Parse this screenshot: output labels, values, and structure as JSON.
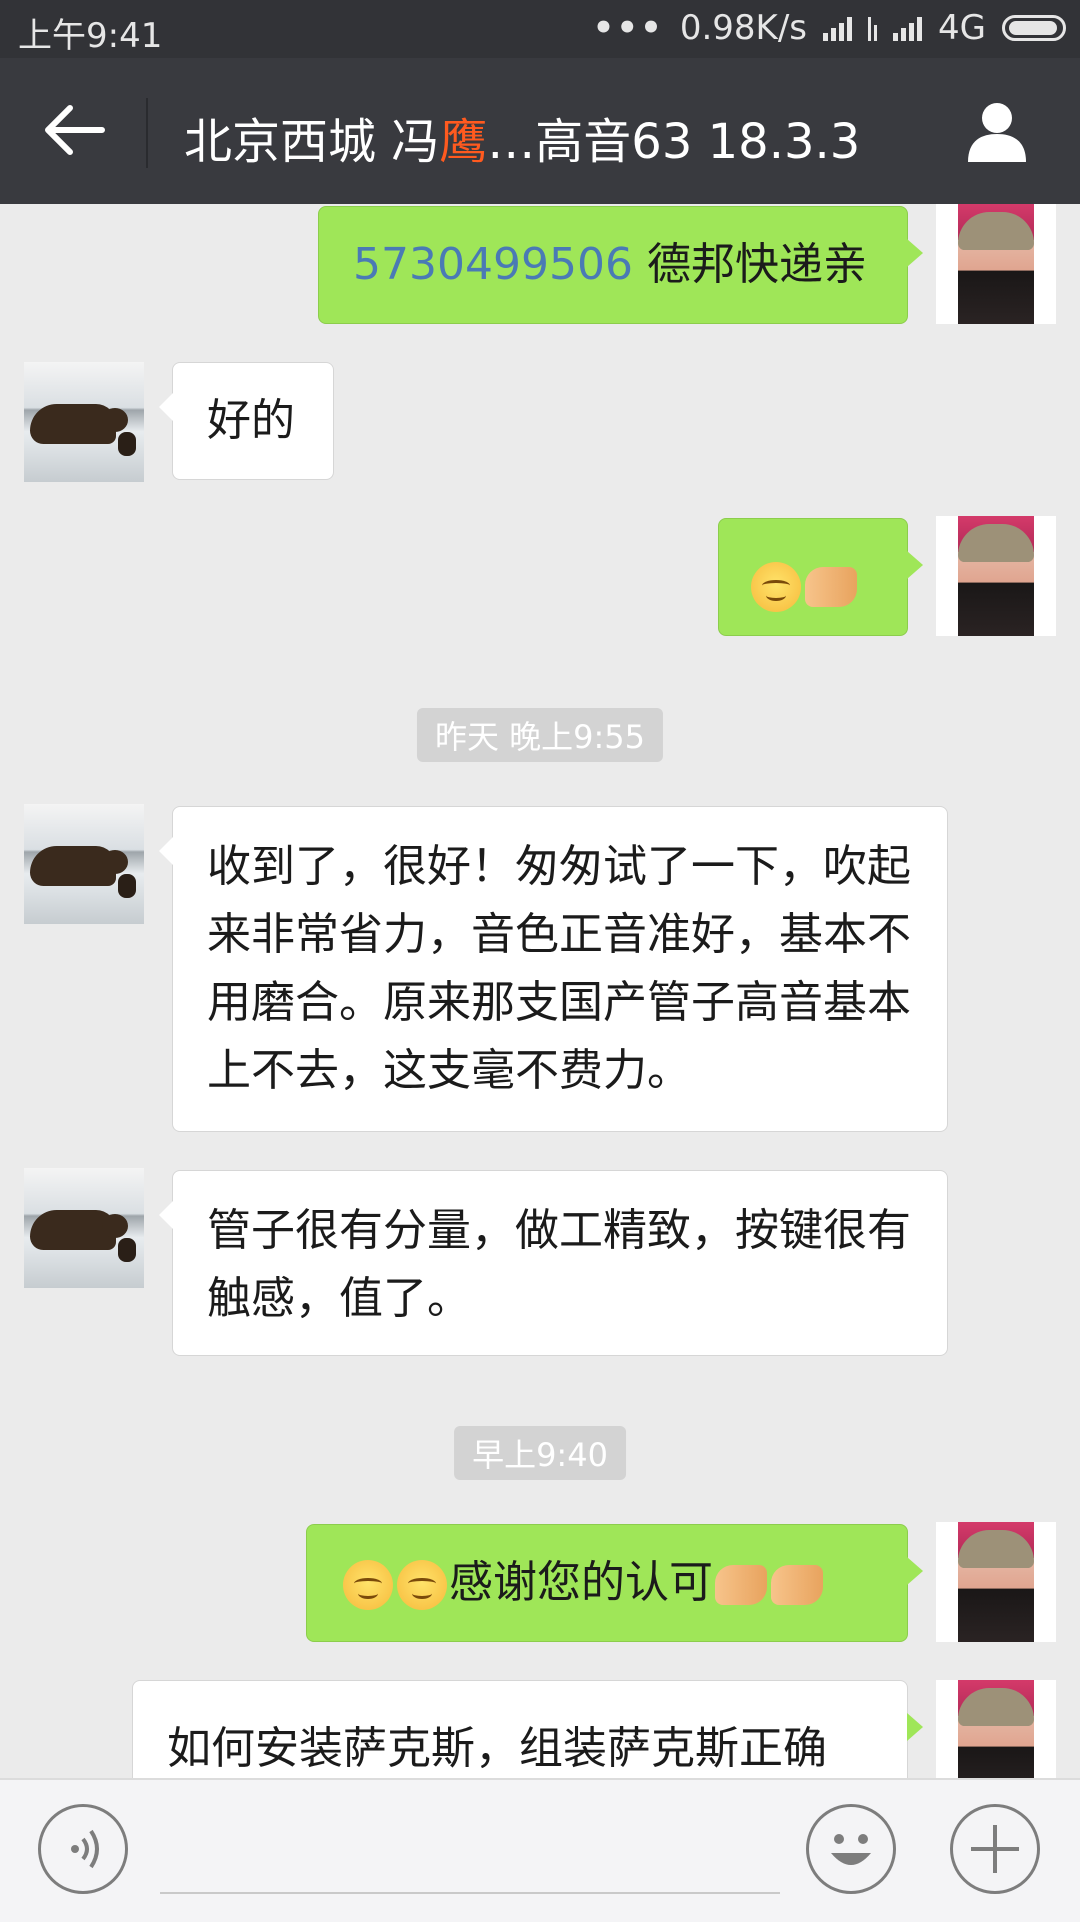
{
  "status_bar": {
    "time": "上午9:41",
    "dots": "•••",
    "speed": "0.98K/s",
    "network": "4G"
  },
  "header": {
    "title_prefix": "北京西城 冯",
    "title_mark": "鹰",
    "title_suffix": "…高音63 18.3.3"
  },
  "messages": {
    "m1": {
      "number": "5730499506",
      "text": " 德邦快递亲"
    },
    "m2": {
      "text": "好的"
    },
    "ts1": "昨天 晚上9:55",
    "m4": {
      "text": "收到了，很好！匆匆试了一下，吹起来非常省力，音色正音准好，基本不用磨合。原来那支国产管子高音基本上不去，这支毫不费力。"
    },
    "m5": {
      "text": "管子很有分量，做工精致，按键很有触感，值了。"
    },
    "ts2": "早上9:40",
    "m6": {
      "text": "感谢您的认可"
    },
    "m7": {
      "text": "如何安装萨克斯，组装萨克斯正确"
    }
  },
  "icons": {
    "back": "back-arrow-icon",
    "profile": "person-icon",
    "voice": "voice-icon",
    "emoji": "emoji-icon",
    "add": "plus-icon"
  },
  "colors": {
    "header_bg": "#393a3f",
    "outgoing_bubble": "#9fe658",
    "incoming_bubble": "#ffffff",
    "chat_bg": "#ebebeb",
    "number_link": "#4a7ab5"
  }
}
